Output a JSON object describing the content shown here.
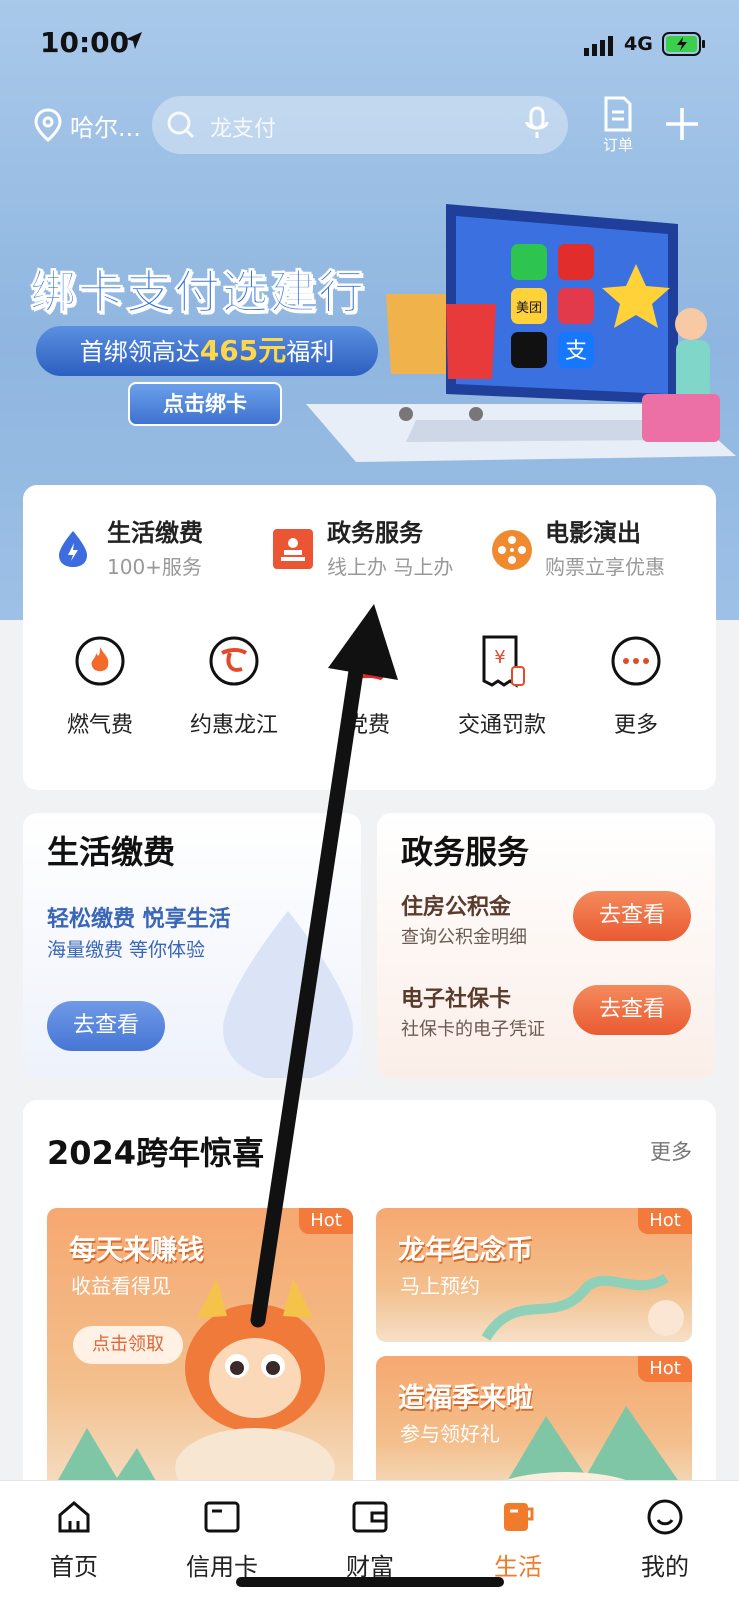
{
  "status_bar": {
    "time": "10:00",
    "network": "4G"
  },
  "header": {
    "city": "哈尔...",
    "search_placeholder": "龙支付",
    "order_label": "订单"
  },
  "banner": {
    "title": "绑卡支付选建行",
    "pill_prefix": "首绑领高达",
    "pill_amount": "465元",
    "pill_suffix": "福利",
    "button": "点击绑卡",
    "app_labels": [
      "美团",
      "支"
    ]
  },
  "categories": [
    {
      "title": "生活缴费",
      "subtitle": "100+服务"
    },
    {
      "title": "政务服务",
      "subtitle": "线上办 马上办"
    },
    {
      "title": "电影演出",
      "subtitle": "购票立享优惠"
    }
  ],
  "quick_items": [
    {
      "label": "燃气费",
      "icon": "flame-icon"
    },
    {
      "label": "约惠龙江",
      "icon": "yuehui-logo-icon"
    },
    {
      "label": "党费",
      "icon": "party-fee-icon"
    },
    {
      "label": "交通罚款",
      "icon": "traffic-fine-icon"
    },
    {
      "label": "更多",
      "icon": "more-icon"
    }
  ],
  "life_card": {
    "title": "生活缴费",
    "line1": "轻松缴费 悦享生活",
    "line2": "海量缴费 等你体验",
    "button": "去查看"
  },
  "gov_card": {
    "title": "政务服务",
    "rows": [
      {
        "title": "住房公积金",
        "subtitle": "查询公积金明细",
        "button": "去查看"
      },
      {
        "title": "电子社保卡",
        "subtitle": "社保卡的电子凭证",
        "button": "去查看"
      }
    ]
  },
  "promo": {
    "title": "2024跨年惊喜",
    "more": "更多",
    "tiles": [
      {
        "title": "每天来赚钱",
        "subtitle": "收益看得见",
        "button": "点击领取",
        "badge": "Hot"
      },
      {
        "title": "龙年纪念币",
        "subtitle": "马上预约",
        "badge": "Hot"
      },
      {
        "title": "造福季来啦",
        "subtitle": "参与领好礼",
        "badge": "Hot"
      }
    ]
  },
  "tabbar": [
    {
      "label": "首页",
      "icon": "home-icon"
    },
    {
      "label": "信用卡",
      "icon": "credit-card-icon"
    },
    {
      "label": "财富",
      "icon": "wallet-icon"
    },
    {
      "label": "生活",
      "icon": "coffee-cup-icon",
      "active": true
    },
    {
      "label": "我的",
      "icon": "smiley-icon"
    }
  ],
  "colors": {
    "accent": "#f07b2a",
    "brand_blue": "#2f6ed6",
    "gov_orange": "#ea5a32"
  }
}
